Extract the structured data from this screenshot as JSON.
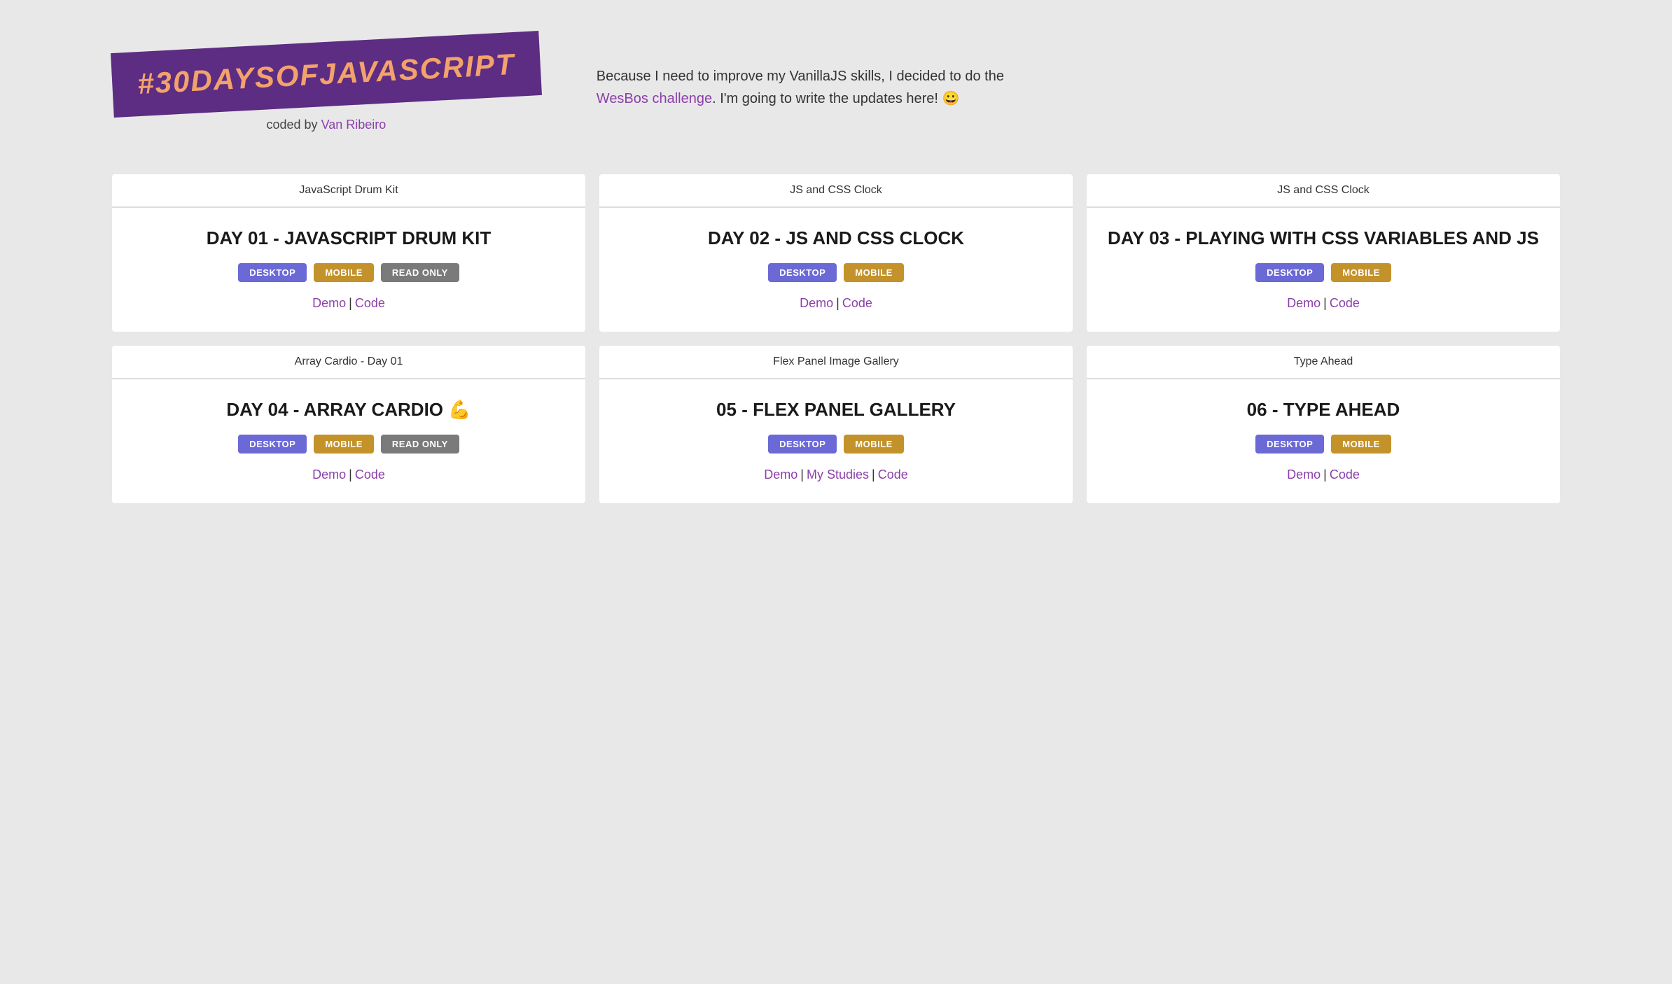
{
  "header": {
    "logo_text": "#30DAYSOFJAVASCRIPT",
    "coded_by_prefix": "coded by ",
    "coded_by_name": "Van Ribeiro",
    "coded_by_url": "#",
    "description_before": "Because I need to improve my VanillaJS skills, I decided to do the ",
    "description_link_text": "WesBos challenge",
    "description_link_url": "#",
    "description_after": ". I'm going to write the updates here! 😀"
  },
  "cards": [
    {
      "subtitle": "JavaScript Drum Kit",
      "title": "DAY 01 - JAVASCRIPT DRUM KIT",
      "badges": [
        "DESKTOP",
        "MOBILE",
        "READ ONLY"
      ],
      "badge_types": [
        "desktop",
        "mobile",
        "readonly"
      ],
      "demo_url": "#",
      "code_url": "#",
      "links": [
        "Demo",
        "Code"
      ]
    },
    {
      "subtitle": "JS and CSS Clock",
      "title": "DAY 02 - JS AND CSS CLOCK",
      "badges": [
        "DESKTOP",
        "MOBILE"
      ],
      "badge_types": [
        "desktop",
        "mobile"
      ],
      "demo_url": "#",
      "code_url": "#",
      "links": [
        "Demo",
        "Code"
      ]
    },
    {
      "subtitle": "JS and CSS Clock",
      "title": "DAY 03 - PLAYING WITH CSS VARIABLES AND JS",
      "badges": [
        "DESKTOP",
        "MOBILE"
      ],
      "badge_types": [
        "desktop",
        "mobile"
      ],
      "demo_url": "#",
      "code_url": "#",
      "links": [
        "Demo",
        "Code"
      ]
    },
    {
      "subtitle": "Array Cardio - Day 01",
      "title": "DAY 04 - ARRAY CARDIO 💪",
      "badges": [
        "DESKTOP",
        "MOBILE",
        "READ ONLY"
      ],
      "badge_types": [
        "desktop",
        "mobile",
        "readonly"
      ],
      "demo_url": "#",
      "code_url": "#",
      "links": [
        "Demo",
        "Code"
      ]
    },
    {
      "subtitle": "Flex Panel Image Gallery",
      "title": "05 - FLEX PANEL GALLERY",
      "badges": [
        "DESKTOP",
        "MOBILE"
      ],
      "badge_types": [
        "desktop",
        "mobile"
      ],
      "demo_url": "#",
      "code_url": "#",
      "links": [
        "Demo",
        "My Studies",
        "Code"
      ]
    },
    {
      "subtitle": "Type Ahead",
      "title": "06 - TYPE AHEAD",
      "badges": [
        "DESKTOP",
        "MOBILE"
      ],
      "badge_types": [
        "desktop",
        "mobile"
      ],
      "demo_url": "#",
      "code_url": "#",
      "links": [
        "Demo",
        "Code"
      ]
    }
  ]
}
